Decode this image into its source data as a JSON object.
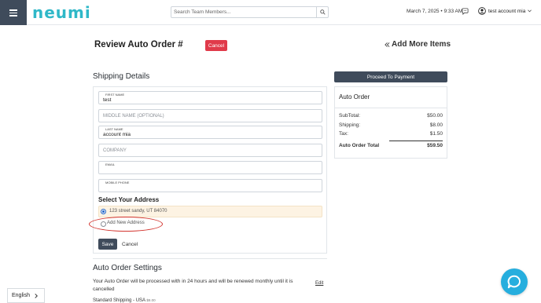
{
  "header": {
    "logo": "neumi",
    "search_placeholder": "Search Team Members...",
    "datetime": "March 7, 2025 • 9:33 AM",
    "user_name": "test account mia"
  },
  "page": {
    "title": "Review Auto Order #",
    "cancel_label": "Cancel",
    "add_more_label": "Add More Items"
  },
  "shipping": {
    "section_title": "Shipping Details",
    "first_name_label": "FIRST NAME",
    "first_name_value": "test",
    "middle_name_placeholder": "MIDDLE NAME (OPTIONAL)",
    "last_name_label": "LAST NAME",
    "last_name_value": "account mia",
    "company_placeholder": "COMPANY",
    "email_label": "EMAIL",
    "email_value": "",
    "mobile_label": "MOBILE PHONE",
    "mobile_value": "",
    "address_title": "Select Your Address",
    "address_selected": "123 street sandy, UT 84070",
    "address_new": "Add New Address",
    "save_label": "Save",
    "cancel_label": "Cancel"
  },
  "settings": {
    "title": "Auto Order Settings",
    "text": "Your Auto Order will be processed with in 24 hours and will be renewed monthly until it is cancelled",
    "edit_label": "Edit",
    "ship_method": "Standard Shipping - USA",
    "ship_price": "$8.00"
  },
  "order": {
    "proceed_label": "Proceed To Payment",
    "title": "Auto Order",
    "rows": [
      {
        "label": "SubTotal:",
        "value": "$50.00"
      },
      {
        "label": "Shipping:",
        "value": "$8.00"
      },
      {
        "label": "Tax:",
        "value": "$1.50"
      }
    ],
    "total_label": "Auto Order Total",
    "total_value": "$59.50"
  },
  "footer": {
    "language": "English"
  },
  "colors": {
    "brand": "#2fb8c8",
    "dark_button": "#3f4b5b",
    "danger": "#e03a4a",
    "chat": "#26aede",
    "highlight_oval": "#d3342e"
  }
}
